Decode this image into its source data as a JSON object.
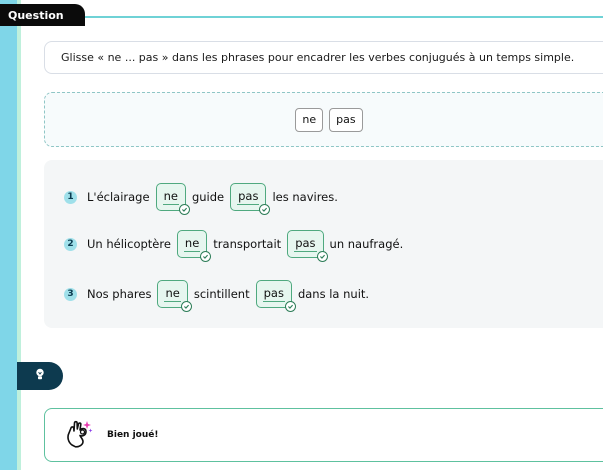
{
  "header": {
    "tab_label": "Question"
  },
  "instruction": "Glisse « ne ... pas » dans les phrases pour encadrer les verbes conjugués à un temps simple.",
  "word_bank": [
    "ne",
    "pas"
  ],
  "sentences": [
    {
      "number": "1",
      "before": "L'éclairage",
      "slot1": "ne",
      "verb": "guide",
      "slot2": "pas",
      "after": "les navires."
    },
    {
      "number": "2",
      "before": "Un hélicoptère",
      "slot1": "ne",
      "verb": "transportait",
      "slot2": "pas",
      "after": "un naufragé."
    },
    {
      "number": "3",
      "before": "Nos phares",
      "slot1": "ne",
      "verb": "scintillent",
      "slot2": "pas",
      "after": "dans la nuit."
    }
  ],
  "hint": {
    "icon": "lightbulb-icon"
  },
  "feedback": {
    "icon": "ok-hand-icon",
    "text": "Bien joué!"
  },
  "colors": {
    "background": "#7fd6e8",
    "accent_teal": "#6fd2d6",
    "correct_green": "#4fa97f",
    "dark_navy": "#0d3a4f"
  }
}
